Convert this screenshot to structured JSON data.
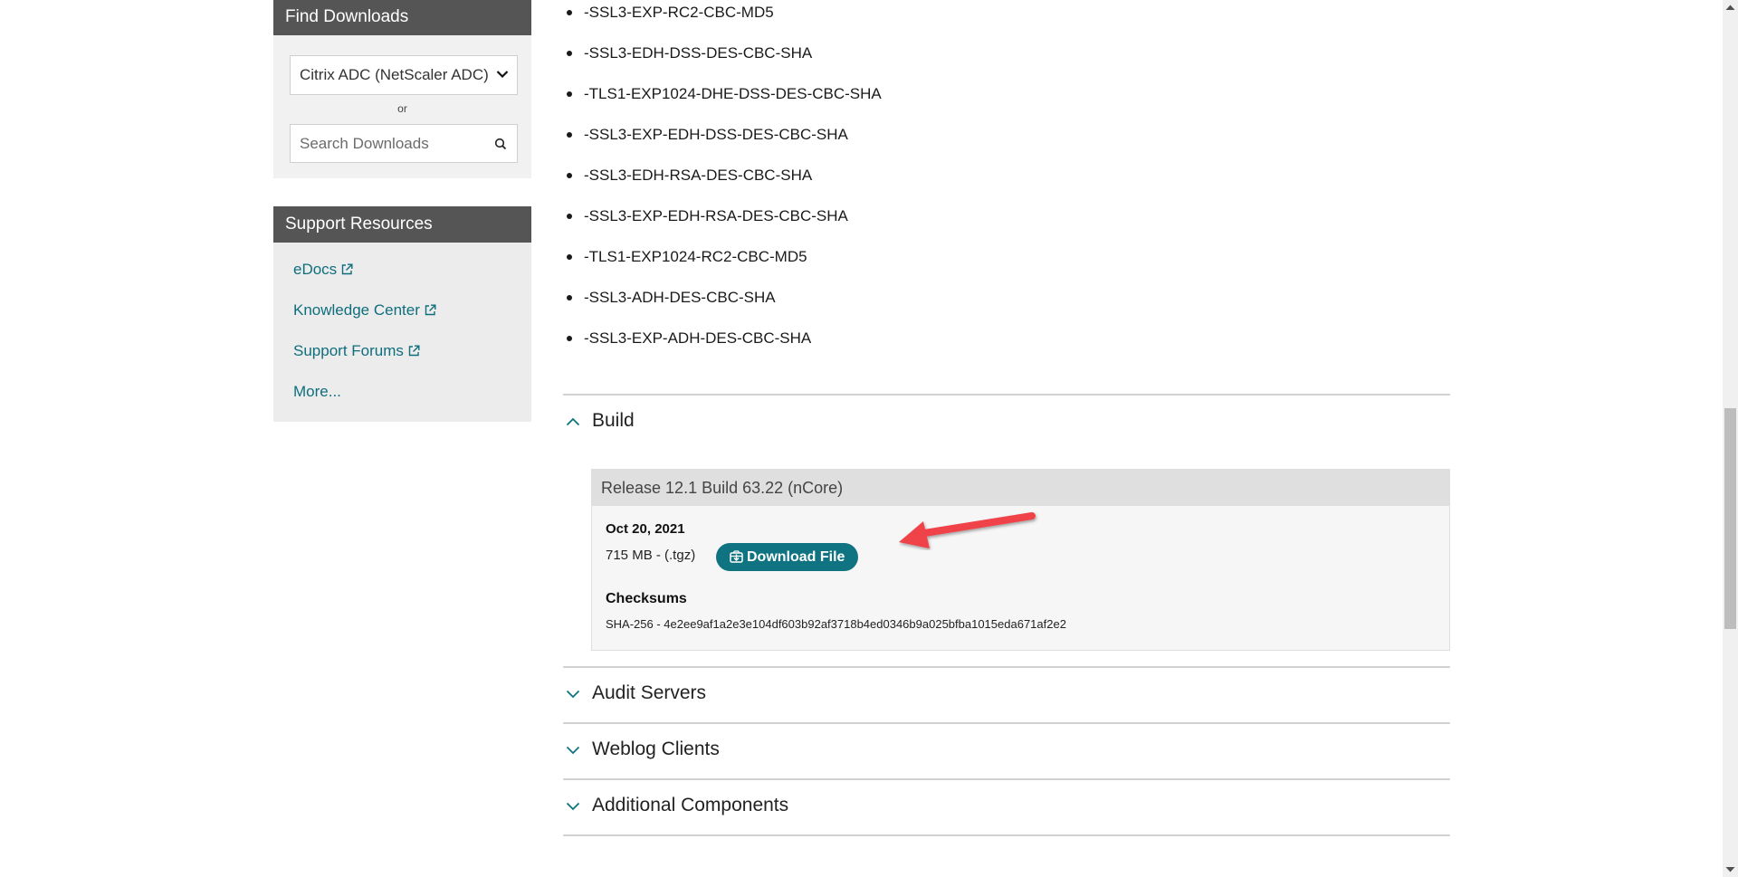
{
  "sidebar": {
    "find_downloads": {
      "title": "Find Downloads",
      "product_select": {
        "selected": "Citrix ADC (NetScaler ADC)"
      },
      "or_label": "or",
      "search": {
        "placeholder": "Search Downloads",
        "value": ""
      }
    },
    "support_resources": {
      "title": "Support Resources",
      "links": [
        {
          "label": "eDocs",
          "external": true
        },
        {
          "label": "Knowledge Center",
          "external": true
        },
        {
          "label": "Support Forums",
          "external": true
        },
        {
          "label": "More...",
          "external": false
        }
      ]
    }
  },
  "main": {
    "ciphers": [
      "-SSL3-EXP-RC2-CBC-MD5",
      "-SSL3-EDH-DSS-DES-CBC-SHA",
      "-TLS1-EXP1024-DHE-DSS-DES-CBC-SHA",
      "-SSL3-EXP-EDH-DSS-DES-CBC-SHA",
      "-SSL3-EDH-RSA-DES-CBC-SHA",
      "-SSL3-EXP-EDH-RSA-DES-CBC-SHA",
      "-TLS1-EXP1024-RC2-CBC-MD5",
      "-SSL3-ADH-DES-CBC-SHA",
      "-SSL3-EXP-ADH-DES-CBC-SHA"
    ],
    "sections": [
      {
        "title": "Build",
        "expanded": true
      },
      {
        "title": "Audit Servers",
        "expanded": false
      },
      {
        "title": "Weblog Clients",
        "expanded": false
      },
      {
        "title": "Additional Components",
        "expanded": false
      }
    ],
    "release": {
      "title": "Release 12.1 Build 63.22 (nCore)",
      "date": "Oct 20, 2021",
      "size": "715 MB - (.tgz)",
      "download_label": "Download File",
      "checksums_label": "Checksums",
      "checksum": "SHA-256 - 4e2ee9af1a2e3e104df603b92af3718b4ed0346b9a025bfba1015eda671af2e2"
    }
  },
  "colors": {
    "accent": "#0f7381",
    "link": "#0f6e7d",
    "panel_header": "#555555",
    "annotation_arrow": "#f0424a"
  }
}
